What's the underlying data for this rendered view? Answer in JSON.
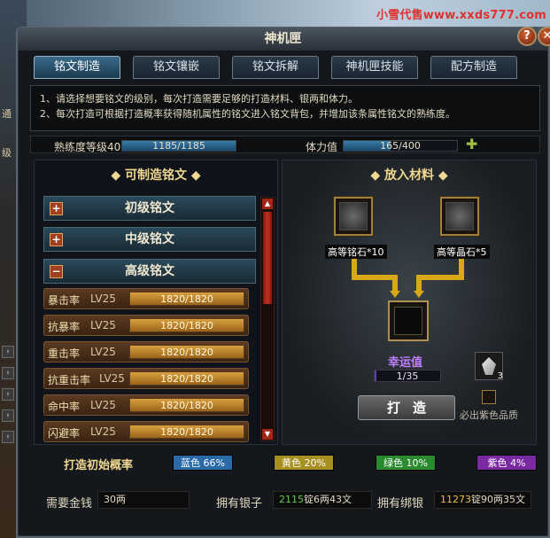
{
  "watermark": "小雪代售www.xxds777.com",
  "window": {
    "title": "神机匣",
    "help": "?",
    "close": "✕"
  },
  "tabs": [
    {
      "label": "铭文制造",
      "active": true
    },
    {
      "label": "铭文镶嵌",
      "active": false
    },
    {
      "label": "铭文拆解",
      "active": false
    },
    {
      "label": "神机匣技能",
      "active": false
    },
    {
      "label": "配方制造",
      "active": false
    }
  ],
  "notice": {
    "line1": "1、请选择想要铭文的级别，每次打造需要足够的打造材料、银两和体力。",
    "line2": "2、每次打造可根据打造概率获得随机属性的铭文进入铭文背包，并增加该条属性铭文的熟练度。"
  },
  "stats": {
    "proficiency_label": "熟练度等级40",
    "proficiency_text": "1185/1185",
    "proficiency_fraction": 1.0,
    "stamina_label": "体力值",
    "stamina_text": "165/400",
    "stamina_fraction": 0.4125
  },
  "left_panel": {
    "title": "◆ 可制造铭文 ◆",
    "categories": [
      {
        "label": "初级铭文",
        "toggle": "+"
      },
      {
        "label": "中级铭文",
        "toggle": "+"
      },
      {
        "label": "高级铭文",
        "toggle": "−"
      }
    ],
    "recipes": [
      {
        "name": "暴击率",
        "level": "LV25",
        "progress": "1820/1820"
      },
      {
        "name": "抗暴率",
        "level": "LV25",
        "progress": "1820/1820"
      },
      {
        "name": "重击率",
        "level": "LV25",
        "progress": "1820/1820"
      },
      {
        "name": "抗重击率",
        "level": "LV25",
        "progress": "1820/1820"
      },
      {
        "name": "命中率",
        "level": "LV25",
        "progress": "1820/1820"
      },
      {
        "name": "闪避率",
        "level": "LV25",
        "progress": "1820/1820"
      }
    ]
  },
  "right_panel": {
    "title": "◆ 放入材料 ◆",
    "material1": "高等铭石*10",
    "material2": "高等晶石*5",
    "luck_title": "幸运值",
    "luck_text": "1/35",
    "luck_fraction": 0.0286,
    "craft_button": "打造",
    "crystal_count": "3",
    "purple_note": "必出紫色品质"
  },
  "rates": {
    "label": "打造初始概率",
    "items": [
      {
        "text": "蓝色 66%",
        "color": "#2a6aa8"
      },
      {
        "text": "黄色 20%",
        "color": "#a89020"
      },
      {
        "text": "绿色 10%",
        "color": "#2a8a30"
      },
      {
        "text": "紫色 4%",
        "color": "#7a2aa0"
      }
    ]
  },
  "footer": {
    "money_label": "需要金钱",
    "money_value": "30两",
    "silver_label": "拥有银子",
    "silver_num": "2115",
    "silver_rest": "锭6两43文",
    "bound_label": "拥有绑银",
    "bound_num": "11273",
    "bound_rest": "锭90两35文"
  },
  "left_edge": {
    "text1": "通",
    "text2": "级"
  }
}
